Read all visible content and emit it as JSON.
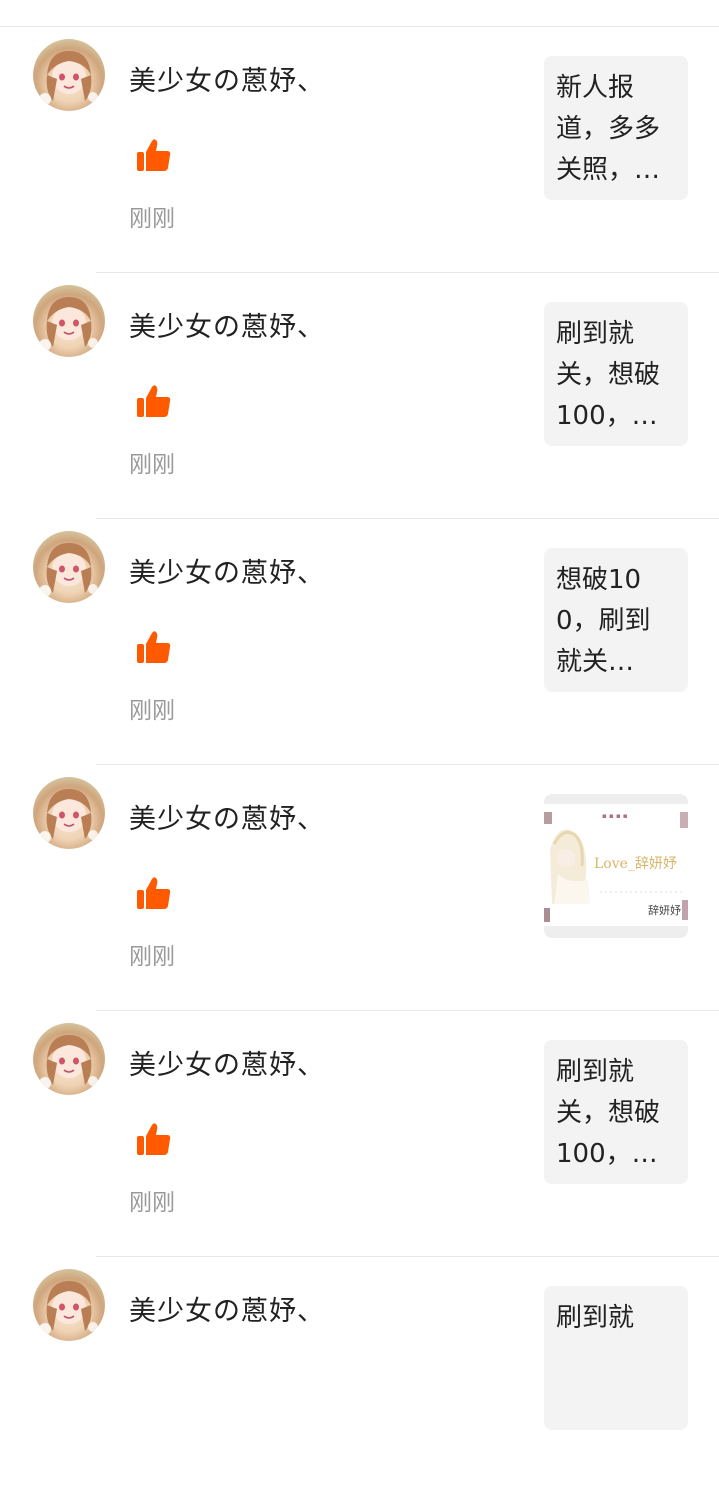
{
  "notifications": [
    {
      "username": "美少女の蒽妤、",
      "time": "刚刚",
      "preview_type": "text",
      "preview_text": "新人报道，多多关照，…",
      "icon": "thumbs-up-icon"
    },
    {
      "username": "美少女の蒽妤、",
      "time": "刚刚",
      "preview_type": "text",
      "preview_text": "刷到就关，想破100，…",
      "icon": "thumbs-up-icon"
    },
    {
      "username": "美少女の蒽妤、",
      "time": "刚刚",
      "preview_type": "text",
      "preview_text": "想破100，刷到就关…",
      "icon": "thumbs-up-icon"
    },
    {
      "username": "美少女の蒽妤、",
      "time": "刚刚",
      "preview_type": "image",
      "preview_text": "",
      "icon": "thumbs-up-icon"
    },
    {
      "username": "美少女の蒽妤、",
      "time": "刚刚",
      "preview_type": "text",
      "preview_text": "刷到就关，想破100，…",
      "icon": "thumbs-up-icon"
    },
    {
      "username": "美少女の蒽妤、",
      "time": "",
      "preview_type": "text",
      "preview_text": "刷到就",
      "icon": "thumbs-up-icon"
    }
  ],
  "colors": {
    "like": "#ff5a00",
    "time": "#9a9a9a",
    "preview_bg": "#f3f3f3"
  },
  "image_preview": {
    "script_text": "Love_辞妍妤",
    "caption": "辞妍妤"
  }
}
